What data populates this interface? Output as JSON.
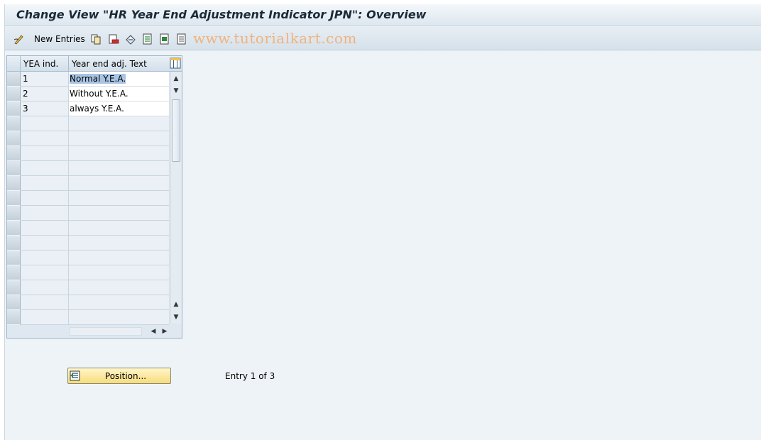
{
  "window": {
    "title": "Change View \"HR Year End Adjustment Indicator JPN\": Overview"
  },
  "toolbar": {
    "new_entries_label": "New Entries",
    "watermark": "www.tutorialkart.com",
    "icons": [
      "pencil-glasses-icon",
      "copy-icon",
      "delete-icon",
      "undo-icon",
      "select-all-icon",
      "select-block-icon",
      "deselect-all-icon"
    ]
  },
  "table": {
    "columns": [
      "YEA ind.",
      "Year end adj. Text"
    ],
    "rows": [
      {
        "ind": "1",
        "text": "Normal Y.E.A."
      },
      {
        "ind": "2",
        "text": "Without Y.E.A."
      },
      {
        "ind": "3",
        "text": "always Y.E.A."
      }
    ]
  },
  "footer": {
    "position_label": "Position...",
    "entry_text": "Entry 1 of 3"
  }
}
